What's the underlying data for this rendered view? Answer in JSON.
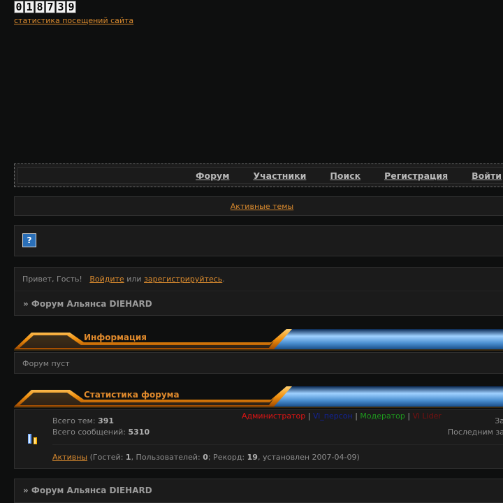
{
  "counter": {
    "digits": [
      "0",
      "1",
      "8",
      "7",
      "3",
      "9"
    ],
    "link": "статистика посещений сайта"
  },
  "nav": {
    "items": [
      "Форум",
      "Участники",
      "Поиск",
      "Регистрация",
      "Войти"
    ]
  },
  "active_topics": "Активные темы",
  "greeting": {
    "prefix": "Привет, Гость!",
    "login": "Войдите",
    "middle": "или",
    "register": "зарегистрируйтесь",
    "suffix": "."
  },
  "breadcrumb": "» Форум Альянса DIEHARD",
  "info": {
    "title": "Информация",
    "text": "Форум пуст"
  },
  "stats": {
    "title": "Статистика форума",
    "topics_label": "Всего тем:",
    "topics_value": "391",
    "messages_label": "Всего сообщений:",
    "messages_value": "5310",
    "legend": [
      "Администратор",
      "Vi_персон",
      "Модератор",
      "Vi Lider"
    ],
    "legend_sep": "|",
    "right1": "Зар",
    "right2": "Последним зар",
    "active_link": "Активны",
    "guests_label": "(Гостей:",
    "guests_value": "1",
    "users_label": ", Пользователей:",
    "users_value": "0",
    "record_label": "; Рекорд:",
    "record_value": "19",
    "record_date": ", установлен 2007-04-09)"
  },
  "colors": {
    "accent": "#d98a2e",
    "admin": "#e01414",
    "moderator": "#1e9a1e"
  },
  "icons": {
    "help": "help-icon",
    "stats": "stats-icon"
  }
}
